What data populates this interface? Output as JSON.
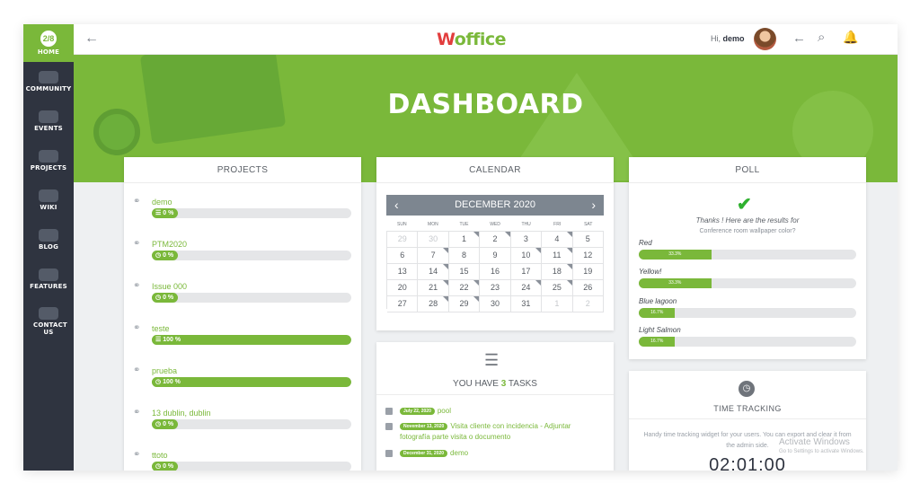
{
  "sidebar": {
    "items": [
      {
        "label": "HOME",
        "badge": "2/8"
      },
      {
        "label": "COMMUNITY"
      },
      {
        "label": "EVENTS"
      },
      {
        "label": "PROJECTS"
      },
      {
        "label": "WIKI"
      },
      {
        "label": "BLOG"
      },
      {
        "label": "FEATURES"
      },
      {
        "label": "CONTACT US"
      }
    ]
  },
  "header": {
    "logo_first": "W",
    "logo_rest": "office",
    "greeting_prefix": "Hi,",
    "username": "demo",
    "back_icon": "arrow-left-icon",
    "search_icon": "search-icon",
    "bell_icon": "bell-icon"
  },
  "hero": {
    "title": "DASHBOARD"
  },
  "projects": {
    "heading": "PROJECTS",
    "items": [
      {
        "name": "demo",
        "progress_label": "0 %",
        "progress": 0,
        "badge_icon": "list-icon"
      },
      {
        "name": "PTM2020",
        "progress_label": "0 %",
        "progress": 0,
        "badge_icon": "clock-icon"
      },
      {
        "name": "Issue 000",
        "progress_label": "0 %",
        "progress": 0,
        "badge_icon": "clock-icon"
      },
      {
        "name": "teste",
        "progress_label": "100 %",
        "progress": 100,
        "badge_icon": "list-icon"
      },
      {
        "name": "prueba",
        "progress_label": "100 %",
        "progress": 100,
        "badge_icon": "clock-icon"
      },
      {
        "name": "13 dublin, dublin",
        "progress_label": "0 %",
        "progress": 0,
        "badge_icon": "clock-icon"
      },
      {
        "name": "ttoto",
        "progress_label": "0 %",
        "progress": 0,
        "badge_icon": "clock-icon"
      }
    ]
  },
  "calendar": {
    "heading": "CALENDAR",
    "month": "DECEMBER 2020",
    "weekdays": [
      "SUN",
      "MON",
      "TUE",
      "WED",
      "THU",
      "FRI",
      "SAT"
    ],
    "days": [
      {
        "d": "29",
        "m": true,
        "e": false
      },
      {
        "d": "30",
        "m": true,
        "e": false
      },
      {
        "d": "1",
        "m": false,
        "e": true
      },
      {
        "d": "2",
        "m": false,
        "e": true
      },
      {
        "d": "3",
        "m": false,
        "e": false
      },
      {
        "d": "4",
        "m": false,
        "e": true
      },
      {
        "d": "5",
        "m": false,
        "e": false
      },
      {
        "d": "6",
        "m": false,
        "e": false
      },
      {
        "d": "7",
        "m": false,
        "e": true
      },
      {
        "d": "8",
        "m": false,
        "e": false
      },
      {
        "d": "9",
        "m": false,
        "e": false
      },
      {
        "d": "10",
        "m": false,
        "e": true
      },
      {
        "d": "11",
        "m": false,
        "e": true
      },
      {
        "d": "12",
        "m": false,
        "e": false
      },
      {
        "d": "13",
        "m": false,
        "e": false
      },
      {
        "d": "14",
        "m": false,
        "e": true
      },
      {
        "d": "15",
        "m": false,
        "e": false
      },
      {
        "d": "16",
        "m": false,
        "e": false
      },
      {
        "d": "17",
        "m": false,
        "e": false
      },
      {
        "d": "18",
        "m": false,
        "e": true
      },
      {
        "d": "19",
        "m": false,
        "e": false
      },
      {
        "d": "20",
        "m": false,
        "e": false
      },
      {
        "d": "21",
        "m": false,
        "e": true
      },
      {
        "d": "22",
        "m": false,
        "e": true
      },
      {
        "d": "23",
        "m": false,
        "e": false
      },
      {
        "d": "24",
        "m": false,
        "e": true
      },
      {
        "d": "25",
        "m": false,
        "e": true
      },
      {
        "d": "26",
        "m": false,
        "e": false
      },
      {
        "d": "27",
        "m": false,
        "e": false
      },
      {
        "d": "28",
        "m": false,
        "e": true
      },
      {
        "d": "29",
        "m": false,
        "e": true
      },
      {
        "d": "30",
        "m": false,
        "e": false
      },
      {
        "d": "31",
        "m": false,
        "e": false
      },
      {
        "d": "1",
        "m": true,
        "e": false
      },
      {
        "d": "2",
        "m": true,
        "e": false
      }
    ]
  },
  "tasks": {
    "title_prefix": "YOU HAVE",
    "count": "3",
    "title_suffix": "TASKS",
    "items": [
      {
        "date": "July 22, 2020",
        "text": "pool"
      },
      {
        "date": "November 13, 2020",
        "text": "Visita cliente con incidencia - Adjuntar fotografía parte visita o documento"
      },
      {
        "date": "December 31, 2020",
        "text": "demo"
      }
    ]
  },
  "poll": {
    "heading": "POLL",
    "thanks": "Thanks ! Here are the results for",
    "question": "Conference room wallpaper color?",
    "results": [
      {
        "name": "Red",
        "percent_label": "33.3%",
        "value": 33.3
      },
      {
        "name": "Yellow!",
        "percent_label": "33.3%",
        "value": 33.3
      },
      {
        "name": "Blue lagoon",
        "percent_label": "16.7%",
        "value": 16.7
      },
      {
        "name": "Light Salmon",
        "percent_label": "16.7%",
        "value": 16.7
      }
    ]
  },
  "time_tracking": {
    "heading": "TIME TRACKING",
    "description": "Handy time tracking widget for your users. You can export and clear it from the admin side.",
    "clock": "02:01:00"
  },
  "watermark": {
    "line1": "Activate Windows",
    "line2": "Go to Settings to activate Windows."
  },
  "colors": {
    "accent": "#7ab83a",
    "sidebar": "#2f3440",
    "check": "#2fb12f"
  }
}
